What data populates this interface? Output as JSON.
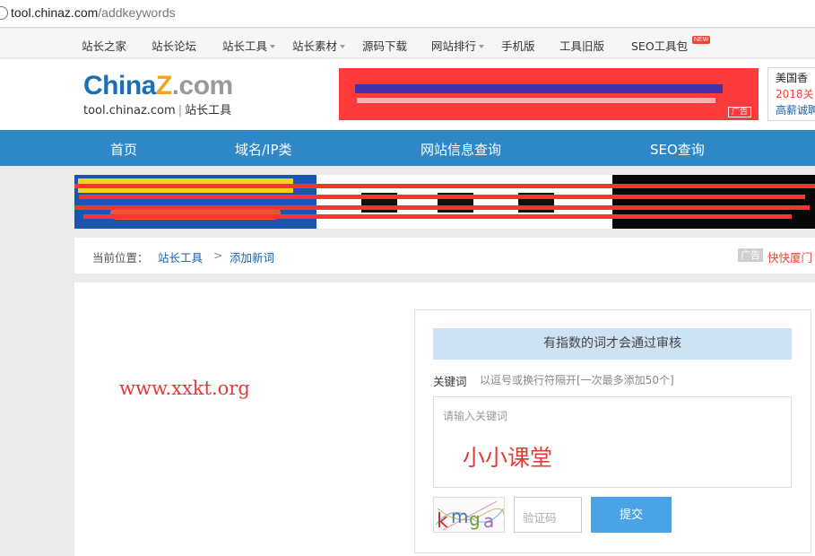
{
  "address_bar": {
    "host": "tool.chinaz.com",
    "path": "/addkeywords"
  },
  "top_nav": {
    "items": [
      {
        "label": "站长之家",
        "dropdown": false
      },
      {
        "label": "站长论坛",
        "dropdown": false
      },
      {
        "label": "站长工具",
        "dropdown": true
      },
      {
        "label": "站长素材",
        "dropdown": true
      },
      {
        "label": "源码下载",
        "dropdown": false
      },
      {
        "label": "网站排行",
        "dropdown": true
      },
      {
        "label": "手机版",
        "dropdown": false
      },
      {
        "label": "工具旧版",
        "dropdown": false
      },
      {
        "label": "SEO工具包",
        "dropdown": false
      }
    ],
    "new_badge": "NEW"
  },
  "header": {
    "logo": {
      "brand_part1": "China",
      "brand_part2": "Z",
      "brand_part3": ".com",
      "domain": "tool.chinaz.com",
      "tagline": "站长工具"
    },
    "ad_tag": "广告",
    "side_ad": {
      "line1": "美国香",
      "line2": "2018关",
      "line3": "高薪诚聘"
    }
  },
  "main_nav": {
    "items": [
      "首页",
      "域名/IP类",
      "网站信息查询",
      "SEO查询"
    ]
  },
  "breadcrumb": {
    "label": "当前位置：",
    "link1": "站长工具",
    "separator": ">",
    "link2": "添加新词",
    "ad_tag": "广告",
    "ad_link": "快快厦门"
  },
  "watermark": "www.xxkt.org",
  "form": {
    "notice": "有指数的词才会通过审核",
    "keyword_label": "关键词",
    "keyword_hint": "以逗号或换行符隔开[一次最多添加50个]",
    "keyword_placeholder": "请输入关键词",
    "handwritten_text": "小小课堂",
    "captcha_text": "kmga",
    "code_placeholder": "验证码",
    "submit_label": "提交"
  },
  "colors": {
    "brand_blue": "#2e88c8",
    "link_blue": "#1a5fa8",
    "button_blue": "#4aa3e4",
    "notice_bg": "#cde2f5",
    "annotation_red": "#e53935"
  }
}
